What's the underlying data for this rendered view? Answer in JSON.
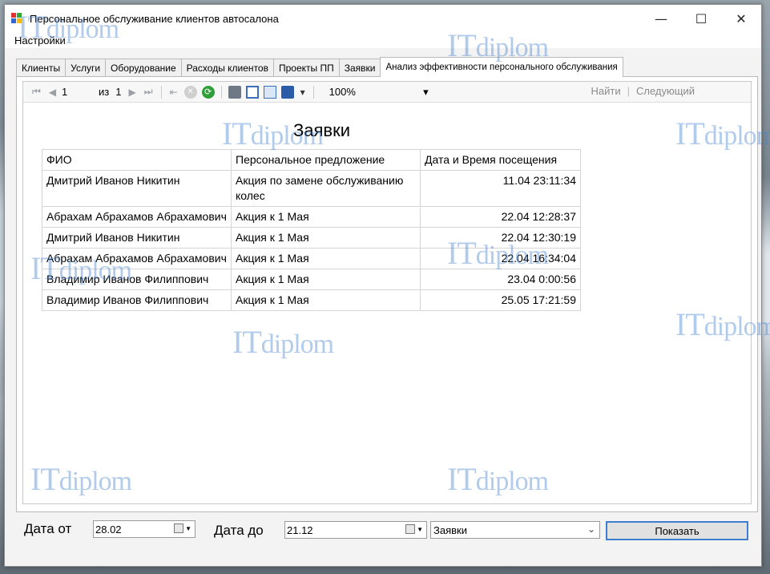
{
  "window": {
    "title": "Персональное обслуживание клиентов автосалона",
    "controls": {
      "minimize": "—",
      "maximize": "☐",
      "close": "✕"
    }
  },
  "menu": {
    "settings": "Настройки"
  },
  "tabs": [
    {
      "label": "Клиенты"
    },
    {
      "label": "Услуги"
    },
    {
      "label": "Оборудование"
    },
    {
      "label": "Расходы клиентов"
    },
    {
      "label": "Проекты ПП"
    },
    {
      "label": "Заявки"
    },
    {
      "label": "Анализ эффективности персонального обслуживания",
      "active": true
    }
  ],
  "toolbar": {
    "first": "⏮",
    "prev": "◀",
    "page_value": "1",
    "of_label": "из",
    "total_pages": "1",
    "next": "▶",
    "last": "⏭",
    "back": "⇤",
    "stop": "✕",
    "refresh": "⟳",
    "zoom": "100%",
    "find": "Найти",
    "next_find": "Следующий"
  },
  "report": {
    "title": "Заявки",
    "columns": [
      "ФИО",
      "Персональное предложение",
      "Дата и Время посещения"
    ],
    "rows": [
      [
        "Дмитрий Иванов Никитин",
        "Акция по замене обслуживанию колес",
        "11.04 23:11:34"
      ],
      [
        "Абрахам Абрахамов Абрахамович",
        "Акция к 1 Мая",
        "22.04 12:28:37"
      ],
      [
        "Дмитрий Иванов Никитин",
        "Акция к 1 Мая",
        "22.04 12:30:19"
      ],
      [
        "Абрахам Абрахамов Абрахамович",
        "Акция к 1 Мая",
        "22.04 16:34:04"
      ],
      [
        "Владимир Иванов Филиппович",
        "Акция к 1 Мая",
        "23.04 0:00:56"
      ],
      [
        "Владимир Иванов Филиппович",
        "Акция к 1 Мая",
        "25.05 17:21:59"
      ]
    ]
  },
  "filters": {
    "date_from_label": "Дата от",
    "date_from": "28.02",
    "date_to_label": "Дата до",
    "date_to": "21.12",
    "report_select": "Заявки",
    "show_button": "Показать"
  },
  "watermark": {
    "it": "IT",
    "diplom": "diplom"
  }
}
